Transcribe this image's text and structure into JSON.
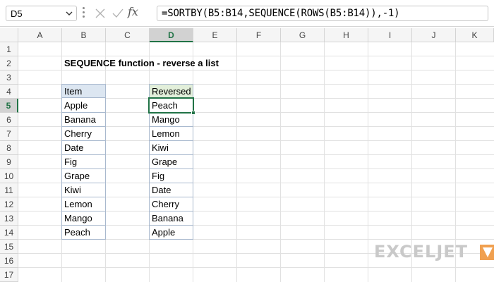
{
  "formula_bar": {
    "name_box": "D5",
    "fx_label": "fx",
    "formula": "=SORTBY(B5:B14,SEQUENCE(ROWS(B5:B14)),-1)"
  },
  "columns": [
    "A",
    "B",
    "C",
    "D",
    "E",
    "F",
    "G",
    "H",
    "I",
    "J",
    "K"
  ],
  "rows": [
    "1",
    "2",
    "3",
    "4",
    "5",
    "6",
    "7",
    "8",
    "9",
    "10",
    "11",
    "12",
    "13",
    "14",
    "15",
    "16",
    "17"
  ],
  "selected": {
    "column": "D",
    "row": "5"
  },
  "sheet": {
    "title": "SEQUENCE function - reverse a list",
    "item_header": "Item",
    "reversed_header": "Reversed",
    "items": [
      "Apple",
      "Banana",
      "Cherry",
      "Date",
      "Fig",
      "Grape",
      "Kiwi",
      "Lemon",
      "Mango",
      "Peach"
    ],
    "reversed": [
      "Peach",
      "Mango",
      "Lemon",
      "Kiwi",
      "Grape",
      "Fig",
      "Date",
      "Cherry",
      "Banana",
      "Apple"
    ]
  },
  "logo": {
    "text": "EXCELJET",
    "accent_color": "#f0a050"
  },
  "colors": {
    "selection_green": "#217346",
    "item_header_bg": "#dce6f1",
    "reversed_header_bg": "#e2efda",
    "table_border": "#a9b9ce"
  }
}
